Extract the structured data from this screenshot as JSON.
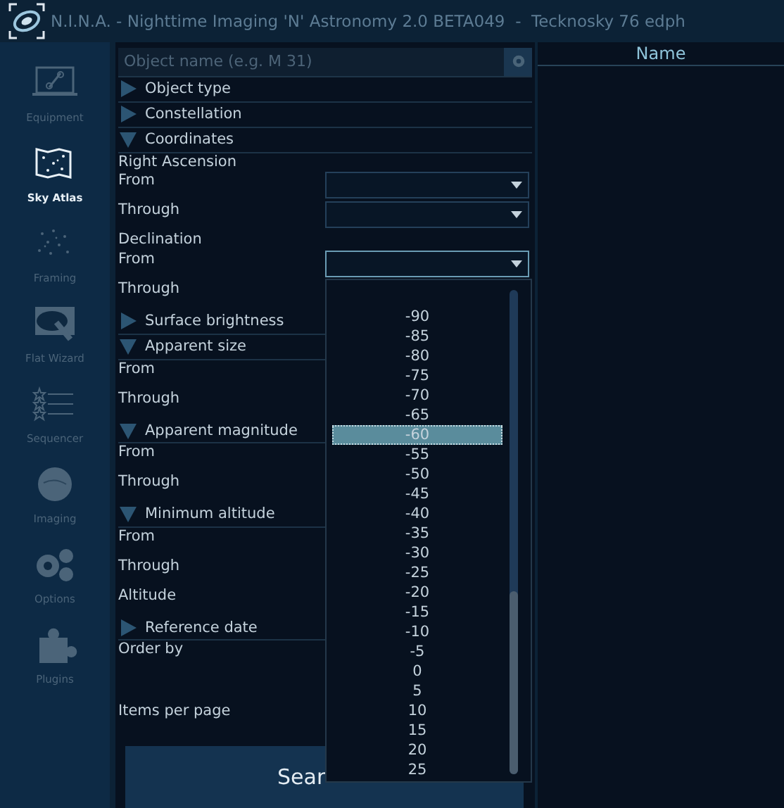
{
  "window": {
    "title": "N.I.N.A. - Nighttime Imaging 'N' Astronomy 2.0 BETA049  -  Tecknosky 76 edph"
  },
  "sidebar": {
    "items": [
      {
        "label": "Equipment",
        "selected": false
      },
      {
        "label": "Sky Atlas",
        "selected": true
      },
      {
        "label": "Framing",
        "selected": false
      },
      {
        "label": "Flat Wizard",
        "selected": false
      },
      {
        "label": "Sequencer",
        "selected": false
      },
      {
        "label": "Imaging",
        "selected": false
      },
      {
        "label": "Options",
        "selected": false
      },
      {
        "label": "Plugins",
        "selected": false
      }
    ]
  },
  "search": {
    "placeholder": "Object name (e.g. M 31)"
  },
  "filters": [
    {
      "kind": "section",
      "label": "Object type",
      "expanded": false
    },
    {
      "kind": "section",
      "label": "Constellation",
      "expanded": false
    },
    {
      "kind": "section",
      "label": "Coordinates",
      "expanded": true
    },
    {
      "kind": "heading",
      "label": "Right Ascension"
    },
    {
      "kind": "field",
      "label": "From",
      "dropdown": {
        "focused": false
      }
    },
    {
      "kind": "field",
      "label": "Through",
      "dropdown": {
        "focused": false
      }
    },
    {
      "kind": "heading",
      "label": "Declination"
    },
    {
      "kind": "field",
      "label": "From",
      "dropdown": {
        "focused": true
      }
    },
    {
      "kind": "field",
      "label": "Through"
    },
    {
      "kind": "section",
      "label": "Surface brightness",
      "expanded": false
    },
    {
      "kind": "section",
      "label": "Apparent size",
      "expanded": true
    },
    {
      "kind": "field",
      "label": "From"
    },
    {
      "kind": "field",
      "label": "Through"
    },
    {
      "kind": "section",
      "label": "Apparent magnitude",
      "expanded": true
    },
    {
      "kind": "field",
      "label": "From"
    },
    {
      "kind": "field",
      "label": "Through"
    },
    {
      "kind": "section",
      "label": "Minimum altitude",
      "expanded": true
    },
    {
      "kind": "field",
      "label": "From"
    },
    {
      "kind": "field",
      "label": "Through"
    },
    {
      "kind": "field",
      "label": "Altitude"
    },
    {
      "kind": "section",
      "label": "Reference date",
      "expanded": false
    },
    {
      "kind": "tall_field",
      "label": "Order by"
    },
    {
      "kind": "field",
      "label": "Items per page"
    }
  ],
  "search_button": {
    "label": "Sear"
  },
  "dropdown_list": {
    "items": [
      {
        "label": "-90",
        "selected": false
      },
      {
        "label": "-85",
        "selected": false
      },
      {
        "label": "-80",
        "selected": false
      },
      {
        "label": "-75",
        "selected": false
      },
      {
        "label": "-70",
        "selected": false
      },
      {
        "label": "-65",
        "selected": false
      },
      {
        "label": "-60",
        "selected": true
      },
      {
        "label": "-55",
        "selected": false
      },
      {
        "label": "-50",
        "selected": false
      },
      {
        "label": "-45",
        "selected": false
      },
      {
        "label": "-40",
        "selected": false
      },
      {
        "label": "-35",
        "selected": false
      },
      {
        "label": "-30",
        "selected": false
      },
      {
        "label": "-25",
        "selected": false
      },
      {
        "label": "-20",
        "selected": false
      },
      {
        "label": "-15",
        "selected": false
      },
      {
        "label": "-10",
        "selected": false
      },
      {
        "label": "-5",
        "selected": false
      },
      {
        "label": "0",
        "selected": false
      },
      {
        "label": "5",
        "selected": false
      },
      {
        "label": "10",
        "selected": false
      },
      {
        "label": "15",
        "selected": false
      },
      {
        "label": "20",
        "selected": false
      },
      {
        "label": "25",
        "selected": false
      }
    ]
  },
  "results": {
    "columns": [
      "Name"
    ]
  }
}
